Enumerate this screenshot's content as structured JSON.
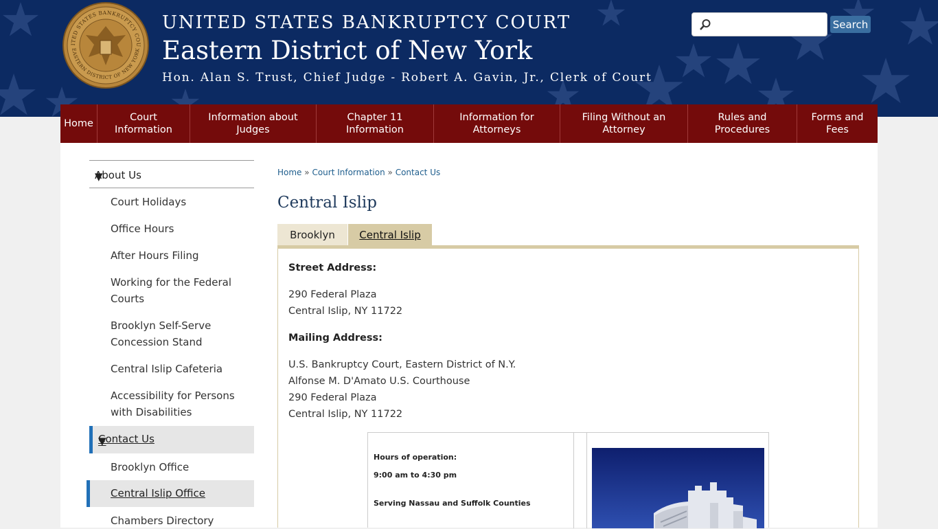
{
  "header": {
    "line1": "UNITED STATES BANKRUPTCY COURT",
    "line2": "Eastern District of New York",
    "line3": "Hon. Alan S. Trust, Chief Judge - Robert A. Gavin, Jr., Clerk of Court",
    "seal_top_text": "UNITED STATES BANKRUPTCY COURT",
    "seal_bottom_text": "EASTERN DISTRICT OF NEW YORK",
    "search_placeholder": "",
    "search_button": "Search"
  },
  "nav": [
    {
      "label": "Home"
    },
    {
      "label": "Court Information"
    },
    {
      "label": "Information about Judges"
    },
    {
      "label": "Chapter 11 Information"
    },
    {
      "label": "Information for Attorneys"
    },
    {
      "label": "Filing Without an Attorney"
    },
    {
      "label": "Rules and Procedures"
    },
    {
      "label": "Forms and Fees"
    }
  ],
  "sidebar": {
    "section": "About Us",
    "items": [
      "Court Holidays",
      "Office Hours",
      "After Hours Filing",
      "Working for the Federal Courts",
      "Brooklyn Self-Serve Concession Stand",
      "Central Islip Cafeteria",
      "Accessibility for Persons with Disabilities"
    ],
    "active_section": "Contact Us",
    "sub_items": [
      "Brooklyn Office",
      "Central Islip Office",
      "Chambers Directory"
    ]
  },
  "breadcrumb": {
    "items": [
      "Home",
      "Court Information",
      "Contact Us"
    ],
    "sep": "»"
  },
  "page_title": "Central Islip",
  "tabs": [
    {
      "label": "Brooklyn"
    },
    {
      "label": "Central Islip"
    }
  ],
  "panel": {
    "street_label": "Street Address:",
    "street_lines": [
      "290 Federal Plaza",
      "Central Islip, NY 11722"
    ],
    "mailing_label": "Mailing Address:",
    "mailing_lines": [
      "U.S. Bankruptcy Court, Eastern District of N.Y.",
      "Alfonse M. D'Amato U.S. Courthouse",
      "290 Federal Plaza",
      "Central Islip, NY 11722"
    ],
    "hours_label": "Hours of operation:",
    "hours_value": "9:00 am to 4:30 pm",
    "serving": "Serving Nassau and Suffolk Counties"
  },
  "colors": {
    "banner": "#0c2a62",
    "nav": "#740b0b",
    "accent": "#2170b8",
    "tab_active": "#d7cba5"
  }
}
